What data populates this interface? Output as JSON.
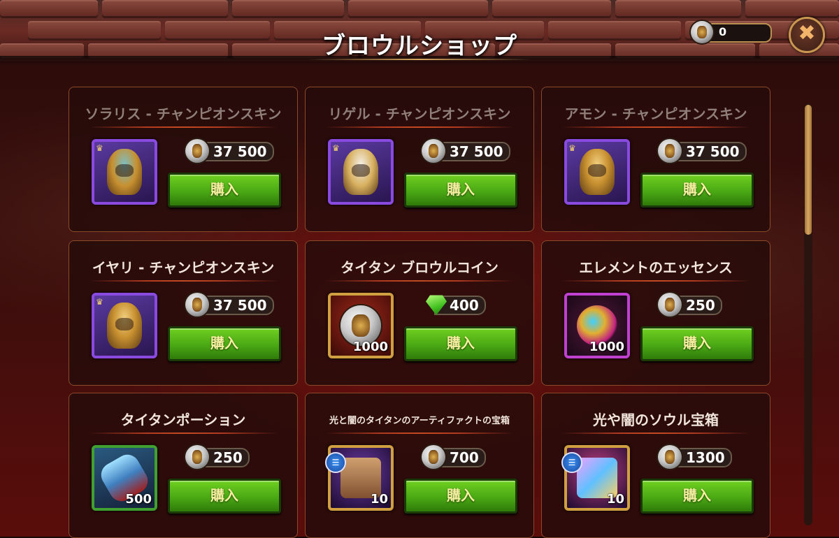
{
  "header": {
    "title": "ブロウルショップ"
  },
  "currency": {
    "value": "0",
    "icon": "brawl-coin-icon"
  },
  "close_button": {
    "icon": "close-icon",
    "glyph": "✖"
  },
  "buy_label": "購入",
  "cards": [
    {
      "title": "ソラリス - チャンピオンスキン",
      "price": "37 500",
      "price_icon": "brawl-coin-icon",
      "quantity": ""
    },
    {
      "title": "リゲル - チャンピオンスキン",
      "price": "37 500",
      "price_icon": "brawl-coin-icon",
      "quantity": ""
    },
    {
      "title": "アモン - チャンピオンスキン",
      "price": "37 500",
      "price_icon": "brawl-coin-icon",
      "quantity": ""
    },
    {
      "title": "イヤリ - チャンピオンスキン",
      "price": "37 500",
      "price_icon": "brawl-coin-icon",
      "quantity": ""
    },
    {
      "title": "タイタン ブロウルコイン",
      "price": "400",
      "price_icon": "emerald-icon",
      "quantity": "1000"
    },
    {
      "title": "エレメントのエッセンス",
      "price": "250",
      "price_icon": "brawl-coin-icon",
      "quantity": "1000"
    },
    {
      "title": "タイタンポーション",
      "price": "250",
      "price_icon": "brawl-coin-icon",
      "quantity": "500"
    },
    {
      "title": "光と闇のタイタンのアーティファクトの宝箱",
      "price": "700",
      "price_icon": "brawl-coin-icon",
      "quantity": "10"
    },
    {
      "title": "光や闇のソウル宝箱",
      "price": "1300",
      "price_icon": "brawl-coin-icon",
      "quantity": "10"
    }
  ]
}
